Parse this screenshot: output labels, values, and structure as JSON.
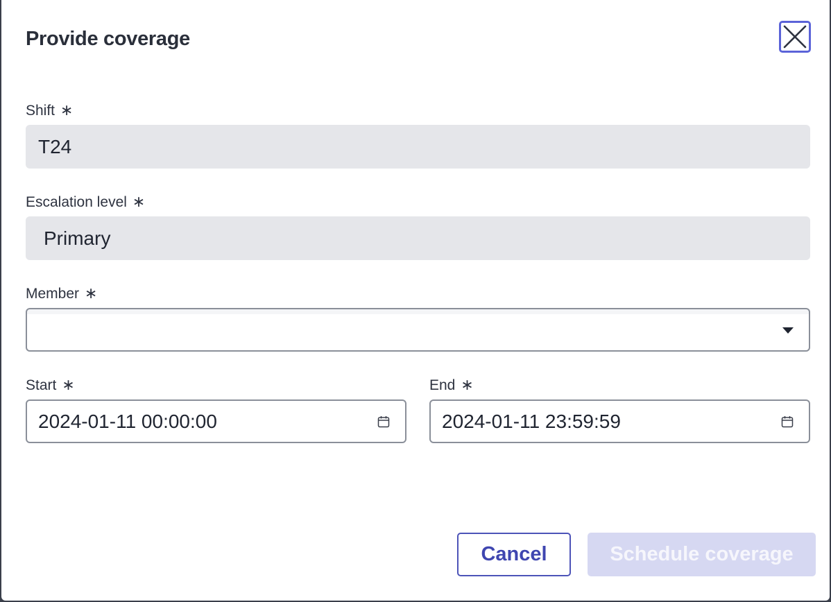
{
  "dialog": {
    "title": "Provide coverage",
    "close_label": "Close"
  },
  "fields": {
    "shift": {
      "label": "Shift",
      "required_mark": "∗",
      "value": "T24"
    },
    "escalation": {
      "label": "Escalation level",
      "required_mark": "∗",
      "value": "Primary"
    },
    "member": {
      "label": "Member",
      "required_mark": "∗",
      "value": ""
    },
    "start": {
      "label": "Start",
      "required_mark": "∗",
      "value": "2024-01-11 00:00:00"
    },
    "end": {
      "label": "End",
      "required_mark": "∗",
      "value": "2024-01-11 23:59:59"
    }
  },
  "actions": {
    "cancel_label": "Cancel",
    "submit_label": "Schedule coverage"
  },
  "icons": {
    "close": "close-icon",
    "caret": "chevron-down-icon",
    "calendar": "calendar-icon"
  },
  "colors": {
    "accent": "#4c53b8",
    "disabled_primary": "#d6d8f2",
    "readonly_bg": "#e5e6ea"
  }
}
